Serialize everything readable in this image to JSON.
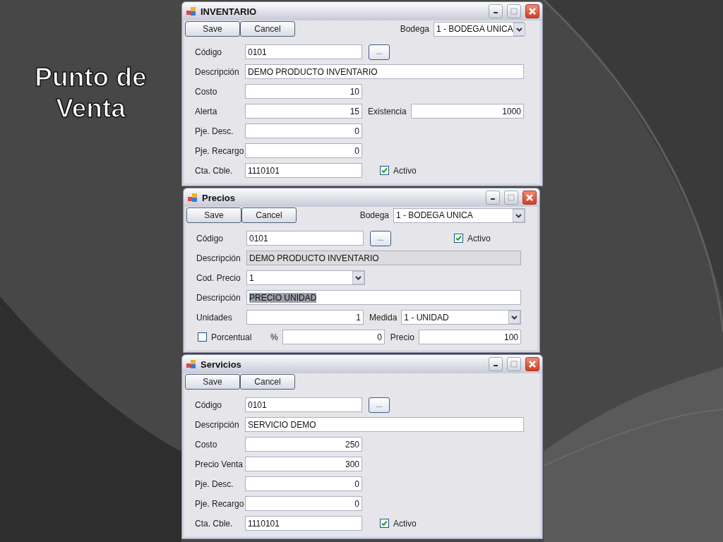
{
  "slide_title": "Punto de Venta",
  "windows": [
    {
      "title": "INVENTARIO",
      "buttons": [
        "Save",
        "Cancel"
      ],
      "bodega": {
        "label": "Bodega",
        "value": "1 - BODEGA UNICA"
      },
      "rows": [
        [
          {
            "kind": "label",
            "text": "Código"
          },
          {
            "kind": "field",
            "value": "0101"
          },
          {
            "kind": "lookup",
            "text": "..."
          }
        ],
        [
          {
            "kind": "label",
            "text": "Descripción"
          },
          {
            "kind": "field_fill",
            "value": "DEMO PRODUCTO INVENTARIO"
          }
        ],
        [
          {
            "kind": "label",
            "text": "Costo"
          },
          {
            "kind": "number",
            "value": "10"
          }
        ],
        [
          {
            "kind": "label",
            "text": "Alerta"
          },
          {
            "kind": "number",
            "value": "15"
          },
          {
            "kind": "label_inline",
            "text": "Existencia"
          },
          {
            "kind": "number_fill",
            "value": "1000"
          }
        ],
        [
          {
            "kind": "label",
            "text": "Pje. Desc."
          },
          {
            "kind": "number",
            "value": "0"
          }
        ],
        [
          {
            "kind": "label",
            "text": "Pje. Recargo"
          },
          {
            "kind": "number",
            "value": "0"
          }
        ],
        [
          {
            "kind": "label",
            "text": "Cta. Cble."
          },
          {
            "kind": "field",
            "value": "1110101"
          },
          {
            "kind": "checkbox",
            "text": "Activo",
            "checked": true
          }
        ]
      ]
    },
    {
      "title": "Precios",
      "buttons": [
        "Save",
        "Cancel"
      ],
      "bodega": {
        "label": "Bodega",
        "value": "1 - BODEGA UNICA"
      },
      "corner_checkbox": {
        "text": "Activo",
        "checked": true
      },
      "rows": [
        [
          {
            "kind": "label",
            "text": "Código"
          },
          {
            "kind": "field",
            "value": "0101"
          },
          {
            "kind": "lookup",
            "text": "..."
          }
        ],
        [
          {
            "kind": "label",
            "text": "Descripción"
          },
          {
            "kind": "field_fill",
            "value": "DEMO PRODUCTO INVENTARIO",
            "disabled": true
          }
        ],
        [
          {
            "kind": "label",
            "text": "Cod. Precio"
          },
          {
            "kind": "select",
            "value": "1"
          }
        ],
        [
          {
            "kind": "label",
            "text": "Descripción"
          },
          {
            "kind": "field_fill",
            "value": "PRECIO UNIDAD",
            "highlighted": true
          }
        ],
        [
          {
            "kind": "label",
            "text": "Unidades"
          },
          {
            "kind": "number",
            "value": "1"
          },
          {
            "kind": "label_inline",
            "text": "Medida"
          },
          {
            "kind": "select_fill",
            "value": "1 - UNIDAD"
          }
        ],
        [
          {
            "kind": "checkbox",
            "text": "Porcentual",
            "checked": false
          },
          {
            "kind": "label_inline",
            "text": "%"
          },
          {
            "kind": "number_fill",
            "value": "0"
          },
          {
            "kind": "label_inline",
            "text": "Precio"
          },
          {
            "kind": "number_fill",
            "value": "100"
          }
        ]
      ]
    },
    {
      "title": "Servicios",
      "buttons": [
        "Save",
        "Cancel"
      ],
      "rows": [
        [
          {
            "kind": "label",
            "text": "Código"
          },
          {
            "kind": "field",
            "value": "0101"
          },
          {
            "kind": "lookup",
            "text": "..."
          }
        ],
        [
          {
            "kind": "label",
            "text": "Descripción"
          },
          {
            "kind": "field_fill",
            "value": "SERVICIO DEMO"
          }
        ],
        [
          {
            "kind": "label",
            "text": "Costo"
          },
          {
            "kind": "number",
            "value": "250"
          }
        ],
        [
          {
            "kind": "label",
            "text": "Precio Venta"
          },
          {
            "kind": "number",
            "value": "300"
          }
        ],
        [
          {
            "kind": "label",
            "text": "Pje. Desc."
          },
          {
            "kind": "number",
            "value": "0"
          }
        ],
        [
          {
            "kind": "label",
            "text": "Pje. Recargo"
          },
          {
            "kind": "number",
            "value": "0"
          }
        ],
        [
          {
            "kind": "label",
            "text": "Cta. Cble."
          },
          {
            "kind": "field",
            "value": "1110101"
          },
          {
            "kind": "checkbox",
            "text": "Activo",
            "checked": true
          }
        ]
      ]
    }
  ]
}
